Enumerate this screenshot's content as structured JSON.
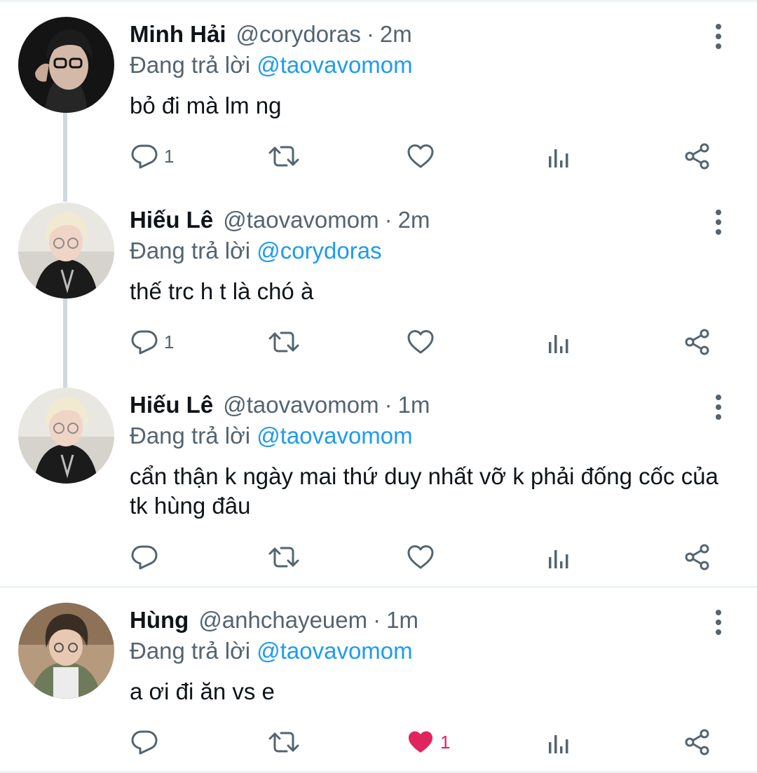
{
  "reply_prefix": "Đang trả lời",
  "tweets": [
    {
      "name": "Minh Hải",
      "handle": "@corydoras",
      "separator": "·",
      "time": "2m",
      "reply_to": "@taovavomom",
      "text": "bỏ đi mà lm ng",
      "reply_count": "1",
      "like_count": "",
      "liked": false
    },
    {
      "name": "Hiếu Lê",
      "handle": "@taovavomom",
      "separator": "·",
      "time": "2m",
      "reply_to": "@corydoras",
      "text": "thế trc h t là chó à",
      "reply_count": "1",
      "like_count": "",
      "liked": false
    },
    {
      "name": "Hiếu Lê",
      "handle": "@taovavomom",
      "separator": "·",
      "time": "1m",
      "reply_to": "@taovavomom",
      "text": "cẩn thận k ngày mai thứ duy nhất vỡ k phải đống cốc của tk hùng đâu",
      "reply_count": "",
      "like_count": "",
      "liked": false
    },
    {
      "name": "Hùng",
      "handle": "@anhchayeuem",
      "separator": "·",
      "time": "1m",
      "reply_to": "@taovavomom",
      "text": "a ơi đi ăn vs e",
      "reply_count": "",
      "like_count": "1",
      "liked": true
    }
  ],
  "colors": {
    "text": "#0f1419",
    "secondary": "#536471",
    "link": "#1d9bf0",
    "like": "#e0245e",
    "thread_line": "#cfd9de",
    "divider": "#eff3f4"
  },
  "icons": [
    "reply-icon",
    "retweet-icon",
    "like-icon",
    "analytics-icon",
    "share-icon",
    "more-options-icon"
  ]
}
